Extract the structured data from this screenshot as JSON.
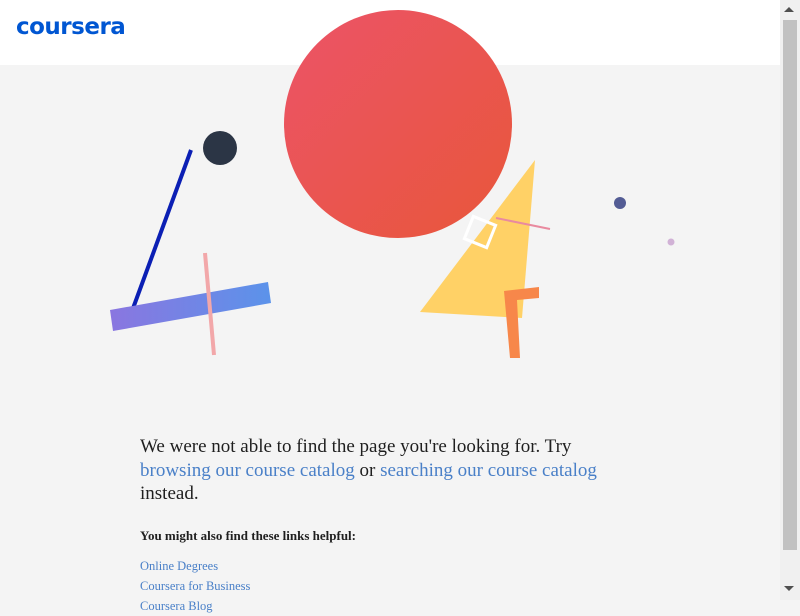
{
  "header": {
    "logo_text": "coursera"
  },
  "message": {
    "part1": "We were not able to find the page you're looking for. Try",
    "link1": "browsing our course catalog",
    "middle": "or",
    "link2": "searching our course catalog",
    "end": "instead."
  },
  "helpful": {
    "heading": "You might also find these links helpful:",
    "links": [
      "Online Degrees",
      "Coursera for Business",
      "Coursera Blog"
    ]
  },
  "colors": {
    "brand": "#0056d2",
    "link": "#4a80c8",
    "background": "#f4f4f4"
  }
}
